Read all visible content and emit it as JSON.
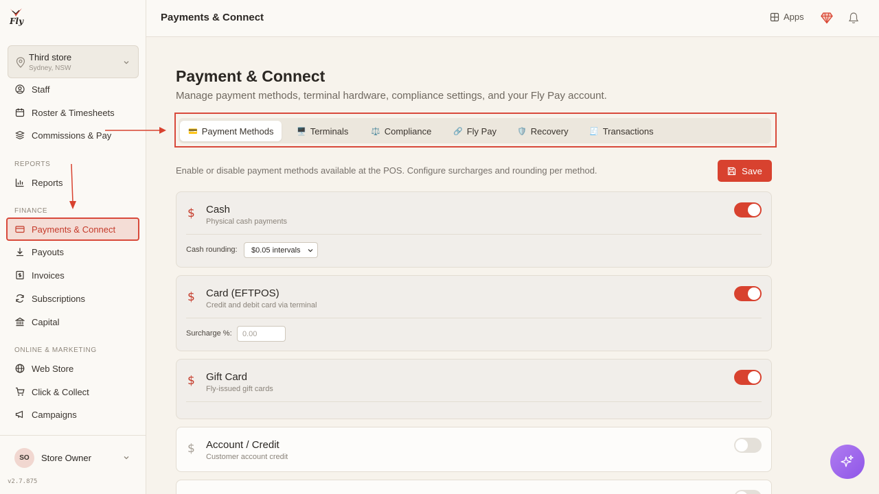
{
  "app": {
    "brand": "Fly",
    "version": "v2.7.875"
  },
  "store": {
    "name": "Third store",
    "location": "Sydney, NSW"
  },
  "sidebar": {
    "items_top": [
      {
        "label": "Staff",
        "icon": "user-circle-icon"
      },
      {
        "label": "Roster & Timesheets",
        "icon": "calendar-icon"
      },
      {
        "label": "Commissions & Pay",
        "icon": "coins-icon"
      }
    ],
    "reports_title": "REPORTS",
    "reports_items": [
      {
        "label": "Reports",
        "icon": "bar-chart-icon"
      }
    ],
    "finance_title": "FINANCE",
    "finance_items": [
      {
        "label": "Payments & Connect",
        "icon": "credit-card-icon",
        "active": true
      },
      {
        "label": "Payouts",
        "icon": "download-icon"
      },
      {
        "label": "Invoices",
        "icon": "invoice-icon"
      },
      {
        "label": "Subscriptions",
        "icon": "refresh-icon"
      },
      {
        "label": "Capital",
        "icon": "bank-icon"
      }
    ],
    "marketing_title": "ONLINE & MARKETING",
    "marketing_items": [
      {
        "label": "Web Store",
        "icon": "globe-icon"
      },
      {
        "label": "Click & Collect",
        "icon": "cart-icon"
      },
      {
        "label": "Campaigns",
        "icon": "megaphone-icon"
      }
    ]
  },
  "user": {
    "initials": "SO",
    "name": "Store Owner"
  },
  "topbar": {
    "title": "Payments & Connect",
    "apps_label": "Apps"
  },
  "page": {
    "title": "Payment & Connect",
    "subtitle": "Manage payment methods, terminal hardware, compliance settings, and your Fly Pay account.",
    "info": "Enable or disable payment methods available at the POS. Configure surcharges and rounding per method.",
    "save_label": "Save"
  },
  "tabs": [
    {
      "label": "Payment Methods",
      "icon": "💳",
      "active": true
    },
    {
      "label": "Terminals",
      "icon": "🖥️"
    },
    {
      "label": "Compliance",
      "icon": "⚖️"
    },
    {
      "label": "Fly Pay",
      "icon": "🔗"
    },
    {
      "label": "Recovery",
      "icon": "🛡️"
    },
    {
      "label": "Transactions",
      "icon": "🧾"
    }
  ],
  "methods": [
    {
      "name": "Cash",
      "desc": "Physical cash payments",
      "enabled": true,
      "field_label": "Cash rounding:",
      "field_value": "$0.05 intervals"
    },
    {
      "name": "Card (EFTPOS)",
      "desc": "Credit and debit card via terminal",
      "enabled": true,
      "field_label": "Surcharge %:",
      "field_placeholder": "0.00"
    },
    {
      "name": "Gift Card",
      "desc": "Fly-issued gift cards",
      "enabled": true
    },
    {
      "name": "Account / Credit",
      "desc": "Customer account credit",
      "enabled": false
    },
    {
      "name": "",
      "desc": "",
      "enabled": false
    }
  ],
  "colors": {
    "accent": "#d8422f",
    "ai_button": "#9b66ec"
  }
}
